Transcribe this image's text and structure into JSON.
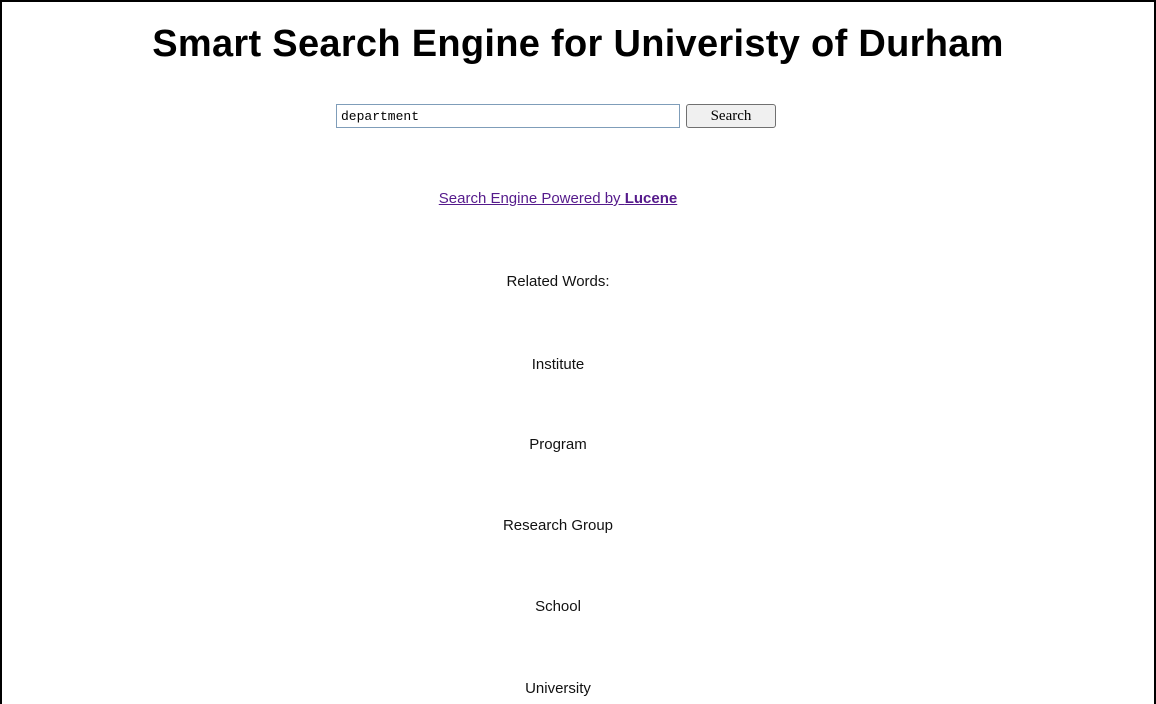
{
  "page": {
    "title": "Smart Search Engine for Univeristy of Durham"
  },
  "search": {
    "query": "department",
    "button_label": "Search"
  },
  "powered_by": {
    "prefix": "Search Engine Powered by ",
    "brand": "Lucene"
  },
  "related": {
    "heading": "Related Words:",
    "words": [
      "Institute",
      "Program",
      "Research Group",
      "School",
      "University"
    ]
  }
}
